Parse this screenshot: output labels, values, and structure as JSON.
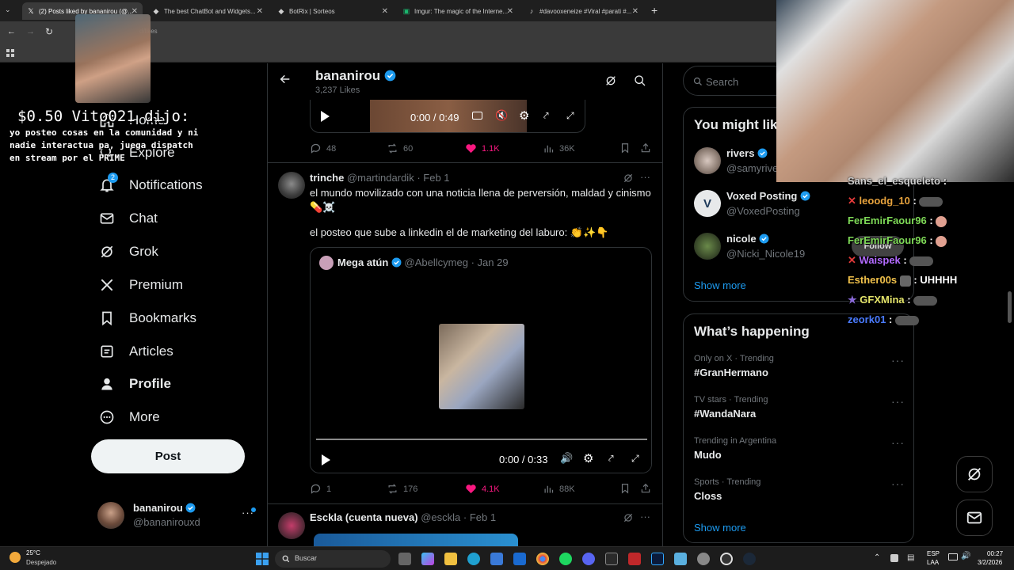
{
  "browser": {
    "tabs": [
      {
        "label": "(2) Posts liked by bananirou (@..."
      },
      {
        "label": "The best ChatBot and Widgets..."
      },
      {
        "label": "BotRix | Sorteos"
      },
      {
        "label": "Imgur: The magic of the Interne..."
      },
      {
        "label": "#davooxeneize #Viral #parati #..."
      }
    ],
    "url": "d/likes"
  },
  "stream_overlay": {
    "donation_header": "$0.50 Vito021 dijo:",
    "donation_message": "yo posteo cosas en la comunidad y ni nadie interactua pa, juega dispatch en stream por el PRIME"
  },
  "nav": {
    "items": [
      {
        "label": "Home"
      },
      {
        "label": "Explore"
      },
      {
        "label": "Notifications",
        "badge": "2"
      },
      {
        "label": "Chat"
      },
      {
        "label": "Grok"
      },
      {
        "label": "Premium"
      },
      {
        "label": "Bookmarks"
      },
      {
        "label": "Articles"
      },
      {
        "label": "Profile"
      },
      {
        "label": "More"
      }
    ],
    "post_button": "Post",
    "account": {
      "name": "bananirou",
      "handle": "@bananirouxd"
    }
  },
  "header": {
    "name": "bananirou",
    "likes": "3,237 Likes"
  },
  "post1": {
    "video_time": "0:00 / 0:49",
    "replies": "48",
    "reposts": "60",
    "likes": "1.1K",
    "views": "36K"
  },
  "post2": {
    "name": "trinche",
    "handle": "@martindardik",
    "date": "Feb 1",
    "text1": "el mundo movilizado con una noticia llena de perversión, maldad y cinismo",
    "text1_emoji": "💊☠️",
    "text2": "el posteo que sube a linkedin el de marketing del laburo:",
    "text2_emoji": "👏✨👇",
    "quote": {
      "name": "Mega atún",
      "handle": "@Abellcymeg",
      "date": "Jan 29",
      "video_time": "0:00 / 0:33"
    },
    "replies": "1",
    "reposts": "176",
    "likes": "4.1K",
    "views": "88K"
  },
  "post3": {
    "name": "Esckla (cuenta nueva)",
    "handle": "@esckla",
    "date": "Feb 1"
  },
  "search": {
    "placeholder": "Search"
  },
  "who_to_follow": {
    "title": "You might like",
    "users": [
      {
        "name": "rivers",
        "handle": "@samyriver"
      },
      {
        "name": "Voxed Posting",
        "handle": "@VoxedPosting",
        "avatar_letter": "V"
      },
      {
        "name": "nicole",
        "handle": "@Nicki_Nicole19"
      }
    ],
    "follow_label": "Follow",
    "show_more": "Show more"
  },
  "trends": {
    "title": "What’s happening",
    "items": [
      {
        "meta": "Only on X · Trending",
        "name": "#GranHermano"
      },
      {
        "meta": "TV stars · Trending",
        "name": "#WandaNara"
      },
      {
        "meta": "Trending in Argentina",
        "name": "Mudo"
      },
      {
        "meta": "Sports · Trending",
        "name": "Closs"
      }
    ],
    "show_more": "Show more"
  },
  "chat": {
    "messages": [
      {
        "user": "Sans_el_esqueleto",
        "text": ":",
        "color": "#cfcfcf"
      },
      {
        "user": "leoodg_10",
        "text": ":",
        "color": "#e8a33d"
      },
      {
        "user": "FerEmirFaour96",
        "text": ":",
        "color": "#7ed957"
      },
      {
        "user": "FerEmirFaour96",
        "text": ":",
        "color": "#7ed957"
      },
      {
        "user": "Waispek",
        "text": ":",
        "color": "#b36bff"
      },
      {
        "user": "Esther00s",
        "text": ": UHHHH",
        "color": "#f0c04a"
      },
      {
        "user": "GFXMina",
        "text": ":",
        "color": "#e3e36a"
      },
      {
        "user": "zeork01",
        "text": ":",
        "color": "#4a7bff"
      }
    ]
  },
  "taskbar": {
    "weather_temp": "25°C",
    "weather_desc": "Despejado",
    "search": "Buscar",
    "lang1": "ESP",
    "lang2": "LAA",
    "time": "00:27",
    "date": "3/2/2026"
  }
}
